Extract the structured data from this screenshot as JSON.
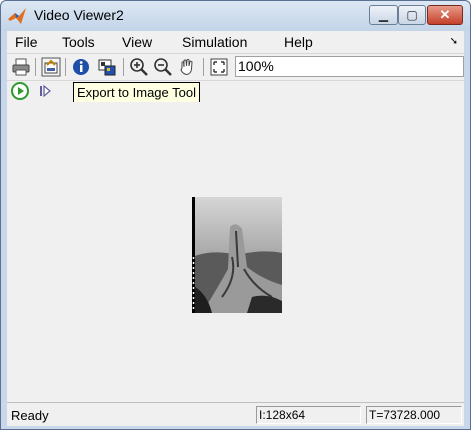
{
  "window": {
    "title": "Video Viewer2"
  },
  "menu": [
    "File",
    "Tools",
    "View",
    "Simulation",
    "Help"
  ],
  "toolbar": {
    "icons": [
      "print-icon",
      "export-icon",
      "info-icon",
      "colormap-icon",
      "zoom-in-icon",
      "zoom-out-icon",
      "pan-hand-icon",
      "fit-to-window-icon"
    ],
    "zoom": "100%"
  },
  "playback": {
    "icons": [
      "play-icon",
      "step-forward-icon"
    ]
  },
  "tooltip": "Export to Image Tool",
  "status": {
    "text": "Ready",
    "dims": "I:128x64",
    "time": "T=73728.000"
  },
  "colors": {
    "title_bar": "#c8d8ea",
    "close_button": "#c4412b",
    "play_green": "#2f9a2f",
    "tooltip_bg": "#ffffe1"
  }
}
